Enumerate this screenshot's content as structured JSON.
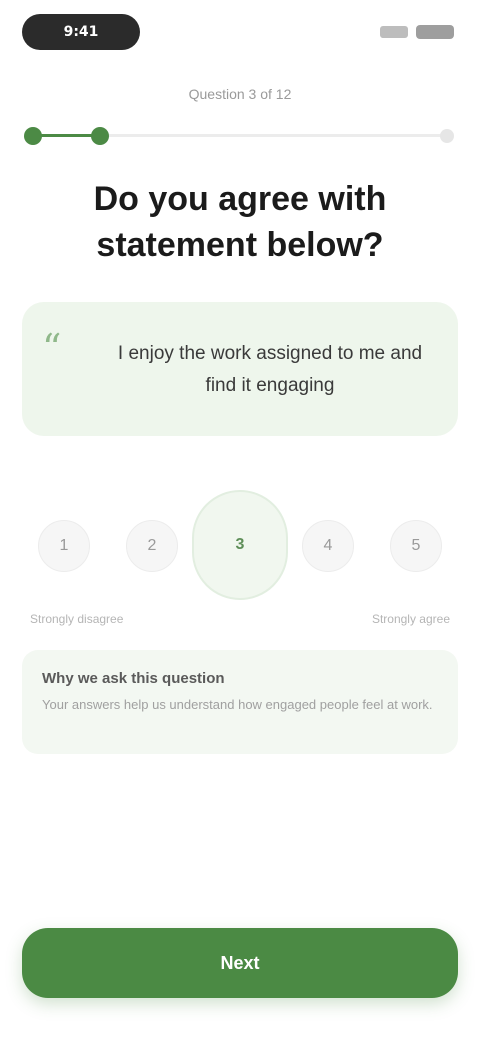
{
  "status_bar": {
    "time": "9:41"
  },
  "progress": {
    "label": "Question 3 of 12",
    "current": 3,
    "total": 12
  },
  "heading": "Do you agree with statement below?",
  "statement": {
    "text": "I enjoy the work assigned to me and find it engaging"
  },
  "scale": {
    "options": [
      "1",
      "2",
      "3",
      "4",
      "5"
    ],
    "selected_index": 2,
    "min_label": "Strongly disagree",
    "max_label": "Strongly agree"
  },
  "info": {
    "title": "Why we ask this question",
    "text": "Your answers help us understand how engaged people feel at work."
  },
  "actions": {
    "next_label": "Next"
  },
  "colors": {
    "accent": "#4b8a44",
    "card_bg": "#eef6ec"
  }
}
